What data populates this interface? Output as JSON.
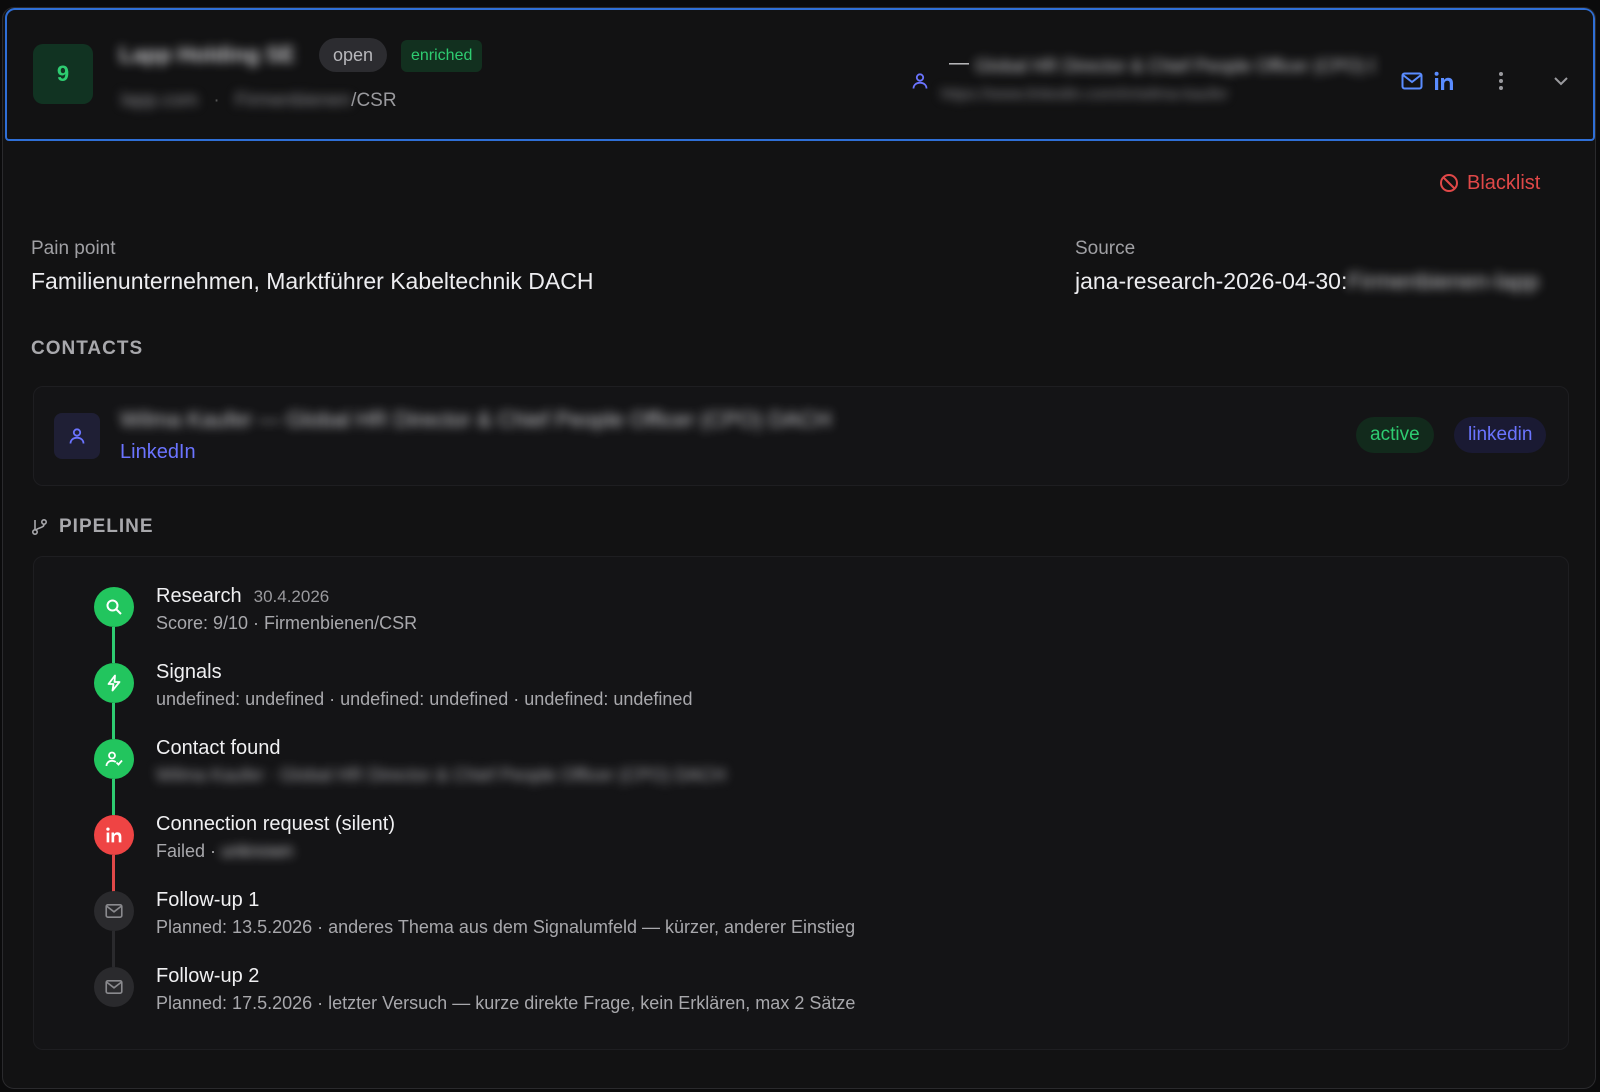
{
  "header": {
    "score": "9",
    "company_name": "Lapp Holding SE",
    "status_open": "open",
    "status_enriched": "enriched",
    "domain": "lapp.com",
    "category_prefix": "Firmenbienen",
    "category_suffix": "/CSR",
    "contact_dash": "—",
    "contact_title": "Global HR Director & Chief People Officer (CPO) DACH",
    "contact_url": "https://www.linkedin.com/in/wilma-kaufer"
  },
  "actions": {
    "blacklist_label": "Blacklist"
  },
  "details": {
    "pain_point_label": "Pain point",
    "pain_point_value": "Familienunternehmen, Marktführer Kabeltechnik DACH",
    "source_label": "Source",
    "source_value": "jana-research-2026-04-30:",
    "source_blurred": "Firmenbienen-lapp"
  },
  "contacts": {
    "title": "CONTACTS",
    "items": [
      {
        "name_line": "Wilma Kaufer — Global HR Director & Chief People Officer (CPO) DACH",
        "link_label": "LinkedIn",
        "tags": [
          "active",
          "linkedin"
        ]
      }
    ]
  },
  "pipeline": {
    "title": "PIPELINE",
    "steps": [
      {
        "title": "Research",
        "date": "30.4.2026",
        "detail": "Score: 9/10 · Firmenbienen/CSR",
        "status": "done",
        "icon": "search-icon"
      },
      {
        "title": "Signals",
        "date": "",
        "detail": "undefined: undefined · undefined: undefined · undefined: undefined",
        "status": "done",
        "icon": "lightning-icon"
      },
      {
        "title": "Contact found",
        "date": "",
        "detail": "Wilma Kaufer · Global HR Director & Chief People Officer (CPO) DACH",
        "status": "done",
        "icon": "user-check-icon"
      },
      {
        "title": "Connection request (silent)",
        "date": "",
        "detail_prefix": "Failed · ",
        "detail_blurred": "unknown",
        "status": "failed",
        "icon": "linkedin-icon"
      },
      {
        "title": "Follow-up 1",
        "date": "",
        "detail": "Planned: 13.5.2026 · anderes Thema aus dem Signalumfeld — kürzer, anderer Einstieg",
        "status": "planned",
        "icon": "mail-icon"
      },
      {
        "title": "Follow-up 2",
        "date": "",
        "detail": "Planned: 17.5.2026 · letzter Versuch — kurze direkte Frage, kein Erklären, max 2 Sätze",
        "status": "planned",
        "icon": "mail-icon"
      }
    ]
  },
  "colors": {
    "accent_blue": "#2f6fd6",
    "success_green": "#2ecc71",
    "danger_red": "#e04848",
    "link_indigo": "#6b74ff"
  }
}
